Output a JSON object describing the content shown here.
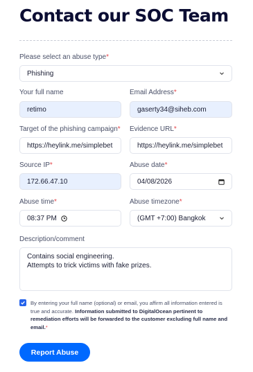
{
  "page": {
    "title": "Contact our SOC Team"
  },
  "form": {
    "abuse_type": {
      "label": "Please select an abuse type",
      "required_mark": "*",
      "value": "Phishing"
    },
    "full_name": {
      "label": "Your full name",
      "value": "retimo"
    },
    "email": {
      "label": "Email Address",
      "required_mark": "*",
      "value": "gaserty34@siheb.com"
    },
    "target": {
      "label": "Target of the phishing campaign",
      "required_mark": "*",
      "value": "https://heylink.me/simplebet"
    },
    "evidence_url": {
      "label": "Evidence URL",
      "required_mark": "*",
      "value": "https://heylink.me/simplebet"
    },
    "source_ip": {
      "label": "Source IP",
      "required_mark": "*",
      "value": "172.66.47.10"
    },
    "abuse_date": {
      "label": "Abuse date",
      "required_mark": "*",
      "value": "04/08/2026"
    },
    "abuse_time": {
      "label": "Abuse time",
      "required_mark": "*",
      "value": "08:37 PM"
    },
    "abuse_timezone": {
      "label": "Abuse timezone",
      "required_mark": "*",
      "value": "(GMT +7:00) Bangkok"
    },
    "description": {
      "label": "Description/comment",
      "value": "Contains social engineering.\nAttempts to trick victims with fake prizes."
    },
    "consent": {
      "checked": true,
      "text_plain": "By entering your full name (optional) or email, you affirm all information entered is true and accurate. ",
      "text_bold": "Information submitted to DigitalOcean pertinent to remediation efforts will be forwarded to the customer excluding full name and email.",
      "required_mark": "*"
    },
    "submit_label": "Report Abuse"
  },
  "colors": {
    "accent": "#0069ff",
    "required": "#e5484d",
    "autofill": "#e8f0fe"
  }
}
